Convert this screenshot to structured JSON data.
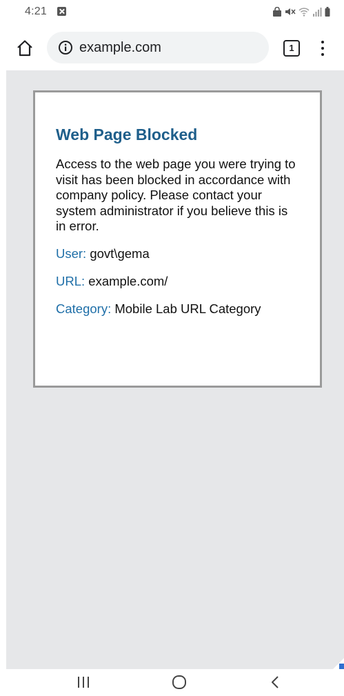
{
  "status_bar": {
    "time": "4:21",
    "icons": [
      "notification-icon",
      "lock-icon",
      "mute-icon",
      "wifi-icon",
      "signal-icon",
      "battery-icon"
    ]
  },
  "toolbar": {
    "url": "example.com",
    "tab_count": "1",
    "icons": [
      "home-icon",
      "info-icon",
      "more-icon"
    ]
  },
  "block_page": {
    "title": "Web Page Blocked",
    "message": "Access to the web page you were trying to visit has been blocked in accordance with company policy. Please contact your system administrator if you believe this is in error.",
    "details": [
      {
        "label": "User:",
        "value": "govt\\gema"
      },
      {
        "label": "URL:",
        "value": "example.com/"
      },
      {
        "label": "Category:",
        "value": "Mobile Lab URL Category"
      }
    ]
  },
  "nav_bar": {
    "icons": [
      "recents-icon",
      "home-icon",
      "back-icon"
    ]
  },
  "colors": {
    "title": "#1f5f8b",
    "label": "#1f6fa8",
    "background": "#e6e7e9",
    "card_border": "#9a9a9a"
  }
}
